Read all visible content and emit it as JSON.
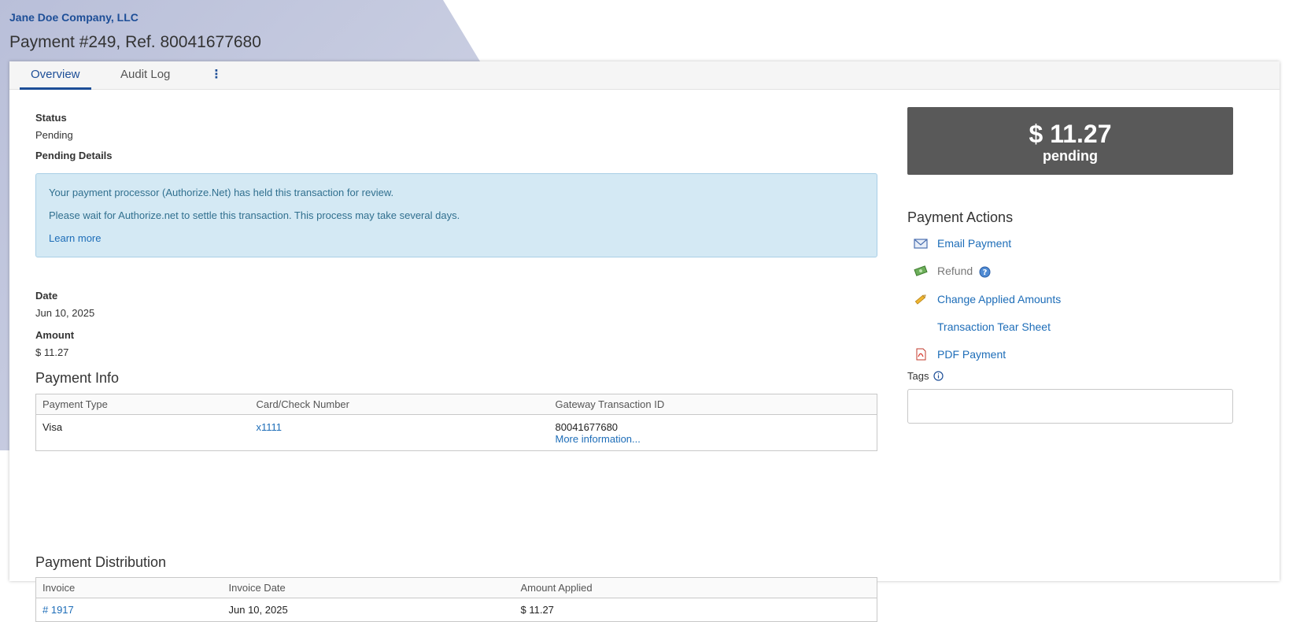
{
  "header": {
    "company": "Jane Doe Company, LLC",
    "title": "Payment #249, Ref. 80041677680"
  },
  "tabs": [
    {
      "label": "Overview",
      "active": true
    },
    {
      "label": "Audit Log",
      "active": false
    },
    {
      "label": "⋮",
      "icon": "more-vertical-icon"
    }
  ],
  "status": {
    "label": "Status",
    "value": "Pending"
  },
  "pending_details": {
    "label": "Pending Details",
    "line1": "Your payment processor (Authorize.Net) has held this transaction for review.",
    "line2": "Please wait for Authorize.net to settle this transaction. This process may take several days.",
    "link": "Learn more"
  },
  "date": {
    "label": "Date",
    "value": "Jun 10, 2025"
  },
  "amount": {
    "label": "Amount",
    "value": "$ 11.27"
  },
  "payment_info": {
    "title": "Payment Info",
    "headers": [
      "Payment Type",
      "Card/Check Number",
      "Gateway Transaction ID"
    ],
    "row": {
      "type": "Visa",
      "card": "x1111",
      "gateway_id": "80041677680",
      "more": "More information..."
    }
  },
  "distribution": {
    "title": "Payment Distribution",
    "headers": [
      "Invoice",
      "Invoice Date",
      "Amount Applied"
    ],
    "rows": [
      {
        "invoice": "# 1917",
        "date": "Jun 10, 2025",
        "amount": "$ 11.27"
      }
    ]
  },
  "summary": {
    "amount": "$ 11.27",
    "status": "pending"
  },
  "actions": {
    "title": "Payment Actions",
    "items": [
      {
        "label": "Email Payment",
        "icon": "envelope-icon",
        "enabled": true
      },
      {
        "label": "Refund",
        "icon": "money-icon",
        "enabled": false
      },
      {
        "label": "Change Applied Amounts",
        "icon": "pencil-icon",
        "enabled": true
      },
      {
        "label": "Transaction Tear Sheet",
        "icon": "",
        "enabled": true
      },
      {
        "label": "PDF Payment",
        "icon": "pdf-icon",
        "enabled": true
      }
    ]
  },
  "tags": {
    "label": "Tags",
    "placeholder": "",
    "value": ""
  },
  "colors": {
    "brand": "#1d4e97",
    "link": "#1d6db8",
    "alert_bg": "#d4e9f4",
    "alert_text": "#31708f",
    "summary_bg": "#595959"
  }
}
